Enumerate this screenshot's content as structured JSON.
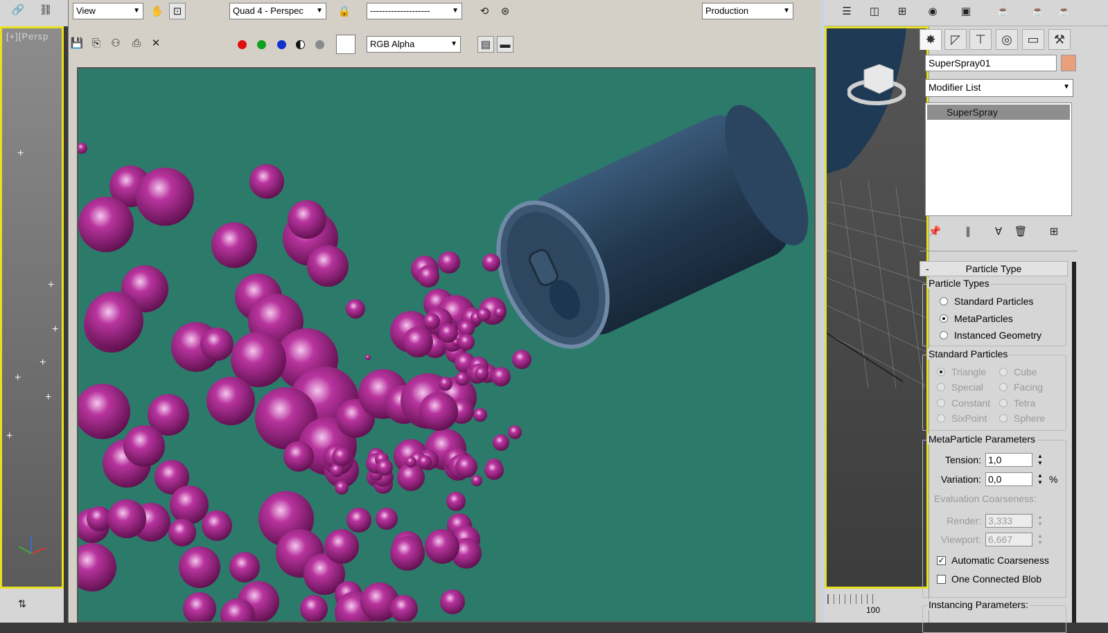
{
  "left_viewport": {
    "label": "[+][Persp"
  },
  "render_window": {
    "area_dropdown": "View",
    "viewport_dropdown": "Quad 4 - Perspec",
    "preset_dropdown": "--------------------",
    "mode_dropdown": "Production",
    "channel_dropdown": "RGB Alpha",
    "colors": {
      "background": "#2c7a6a",
      "particles": "#9a2a8a",
      "can": "#2b4560"
    }
  },
  "command_panel": {
    "object_name": "SuperSpray01",
    "object_color": "#e8a07a",
    "modifier_list": "Modifier List",
    "stack_item": "SuperSpray",
    "rollout": {
      "collapse": "-",
      "title": "Particle Type",
      "particle_types": {
        "label": "Particle Types",
        "options": [
          "Standard Particles",
          "MetaParticles",
          "Instanced Geometry"
        ],
        "selected": "MetaParticles"
      },
      "standard_particles": {
        "label": "Standard Particles",
        "options": [
          "Triangle",
          "Cube",
          "Special",
          "Facing",
          "Constant",
          "Tetra",
          "SixPoint",
          "Sphere"
        ],
        "selected": "Triangle"
      },
      "meta_parameters": {
        "label": "MetaParticle Parameters",
        "tension_label": "Tension:",
        "tension_value": "1,0",
        "variation_label": "Variation:",
        "variation_value": "0,0",
        "variation_unit": "%",
        "coarseness_label": "Evaluation Coarseness:",
        "render_label": "Render:",
        "render_value": "3,333",
        "viewport_label": "Viewport:",
        "viewport_value": "6,667",
        "auto_coarseness_label": "Automatic Coarseness",
        "auto_coarseness_checked": true,
        "one_blob_label": "One Connected Blob",
        "one_blob_checked": false
      },
      "instancing_label": "Instancing Parameters:"
    }
  },
  "status": {
    "bottom_number": "100"
  }
}
